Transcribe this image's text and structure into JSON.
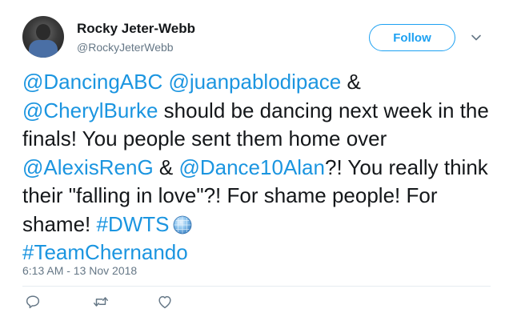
{
  "author": {
    "display_name": "Rocky Jeter-Webb",
    "handle": "@RockyJeterWebb"
  },
  "follow_label": "Follow",
  "tweet": {
    "parts": [
      {
        "text": "@DancingABC",
        "type": "mention"
      },
      {
        "text": " ",
        "type": "text"
      },
      {
        "text": "@juanpablodipace",
        "type": "mention"
      },
      {
        "text": " & ",
        "type": "text"
      },
      {
        "text": "@CherylBurke",
        "type": "mention"
      },
      {
        "text": " should be dancing next week in the finals! You people sent them home over ",
        "type": "text"
      },
      {
        "text": "@AlexisRenG",
        "type": "mention"
      },
      {
        "text": " & ",
        "type": "text"
      },
      {
        "text": "@Dance10Alan",
        "type": "mention"
      },
      {
        "text": "?! You really think their \"falling in love\"?! For shame people! For shame! ",
        "type": "text"
      },
      {
        "text": "#DWTS",
        "type": "hashtag"
      },
      {
        "text": " ",
        "type": "text"
      },
      {
        "text": "#TeamChernando",
        "type": "hashtag"
      }
    ]
  },
  "timestamp": "6:13 AM - 13 Nov 2018",
  "icons": {
    "reply": "reply-icon",
    "retweet": "retweet-icon",
    "like": "heart-icon",
    "more": "chevron-down-icon",
    "hashtag_emoji": "disco-ball-icon"
  },
  "colors": {
    "link": "#1b95e0",
    "follow": "#1da1f2",
    "muted": "#657786",
    "text": "#14171a"
  }
}
